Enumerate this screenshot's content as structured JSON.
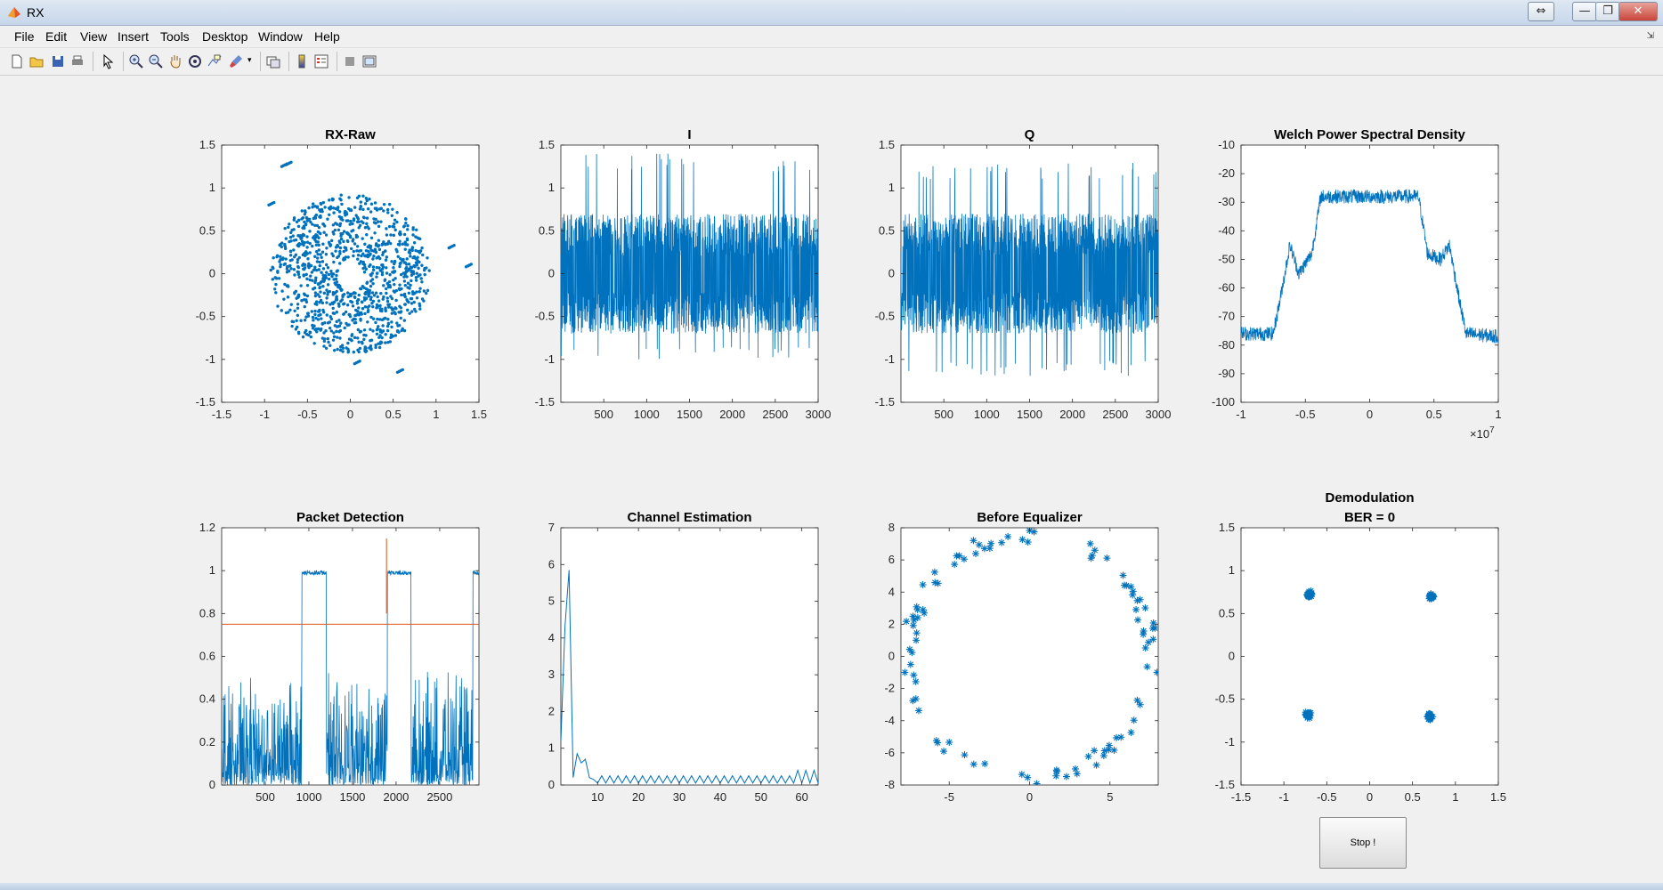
{
  "window": {
    "title": "RX",
    "controls": {
      "restore": "⇔",
      "minimize": "—",
      "maximize": "❐",
      "close": "✕"
    }
  },
  "menu": [
    "File",
    "Edit",
    "View",
    "Insert",
    "Tools",
    "Desktop",
    "Window",
    "Help"
  ],
  "toolbar": {
    "icons": [
      "new-figure-icon",
      "open-file-icon",
      "save-icon",
      "print-icon",
      "edit-plot-arrow-icon",
      "zoom-in-icon",
      "zoom-out-icon",
      "pan-hand-icon",
      "rotate-3d-icon",
      "data-cursor-icon",
      "brush-icon",
      "link-plot-icon",
      "colorbar-icon",
      "legend-icon",
      "hide-plot-tools-icon",
      "show-plot-tools-icon"
    ]
  },
  "stop_button": {
    "label": "Stop !"
  },
  "colors": {
    "series": "#0072bd",
    "threshold": "#d95319",
    "axes": "#262626"
  },
  "chart_data": [
    {
      "type": "scatter",
      "title": "RX-Raw",
      "xlim": [
        -1.5,
        1.5
      ],
      "ylim": [
        -1.5,
        1.5
      ],
      "xticks": [
        "-1.5",
        "-1",
        "-0.5",
        "0",
        "0.5",
        "1",
        "1.5"
      ],
      "yticks": [
        "-1.5",
        "-1",
        "-0.5",
        "0",
        "0.5",
        "1",
        "1.5"
      ],
      "marker": "dot",
      "description_of_points": "ring of points centred at origin radius up to ~0.9, plus outliers",
      "outliers": [
        [
          -0.8,
          1.25
        ],
        [
          -0.75,
          1.27
        ],
        [
          -0.95,
          0.8
        ],
        [
          1.15,
          0.3
        ],
        [
          1.35,
          0.08
        ],
        [
          0.55,
          -1.15
        ],
        [
          0.05,
          -1.05
        ]
      ]
    },
    {
      "type": "line",
      "title": "I",
      "xlim": [
        0,
        3000
      ],
      "ylim": [
        -1.5,
        1.5
      ],
      "xticks": [
        "500",
        "1000",
        "1500",
        "2000",
        "2500",
        "3000"
      ],
      "yticks": [
        "-1.5",
        "-1",
        "-0.5",
        "0",
        "0.5",
        "1",
        "1.5"
      ],
      "envelope": {
        "upper": 0.7,
        "lower": -0.7,
        "spike_max": 1.4,
        "spike_min": -1.0
      }
    },
    {
      "type": "line",
      "title": "Q",
      "xlim": [
        0,
        3000
      ],
      "ylim": [
        -1.5,
        1.5
      ],
      "xticks": [
        "500",
        "1000",
        "1500",
        "2000",
        "2500",
        "3000"
      ],
      "yticks": [
        "-1.5",
        "-1",
        "-0.5",
        "0",
        "0.5",
        "1",
        "1.5"
      ],
      "envelope": {
        "upper": 0.7,
        "lower": -0.7,
        "spike_max": 1.3,
        "spike_min": -1.2
      }
    },
    {
      "type": "line",
      "title": "Welch Power Spectral Density",
      "xlim": [
        -1,
        1
      ],
      "ylim": [
        -100,
        -10
      ],
      "xticks": [
        "-1",
        "-0.5",
        "0",
        "0.5",
        "1"
      ],
      "yticks": [
        "-100",
        "-90",
        "-80",
        "-70",
        "-60",
        "-50",
        "-40",
        "-30",
        "-20",
        "-10"
      ],
      "x_exponent": "7",
      "profile": [
        [
          -1,
          -76
        ],
        [
          -0.75,
          -76
        ],
        [
          -0.7,
          -65
        ],
        [
          -0.62,
          -45
        ],
        [
          -0.55,
          -55
        ],
        [
          -0.45,
          -48
        ],
        [
          -0.38,
          -28
        ],
        [
          0.38,
          -28
        ],
        [
          0.45,
          -48
        ],
        [
          0.55,
          -50
        ],
        [
          0.62,
          -45
        ],
        [
          0.7,
          -65
        ],
        [
          0.75,
          -76
        ],
        [
          1,
          -77
        ]
      ]
    },
    {
      "type": "line",
      "title": "Packet Detection",
      "xlim": [
        0,
        2950
      ],
      "ylim": [
        0,
        1.2
      ],
      "xticks": [
        "500",
        "1000",
        "1500",
        "2000",
        "2500"
      ],
      "yticks": [
        "0",
        "0.2",
        "0.4",
        "0.6",
        "0.8",
        "1",
        "1.2"
      ],
      "threshold": 0.75,
      "plateaus": [
        [
          920,
          1200
        ],
        [
          1900,
          2170
        ],
        [
          2880,
          2950
        ]
      ],
      "marker_x": 1890,
      "marker_range": [
        0.8,
        1.15
      ]
    },
    {
      "type": "line",
      "title": "Channel Estimation",
      "xlim": [
        1,
        64
      ],
      "ylim": [
        0,
        7
      ],
      "xticks": [
        "10",
        "20",
        "30",
        "40",
        "50",
        "60"
      ],
      "yticks": [
        "0",
        "1",
        "2",
        "3",
        "4",
        "5",
        "6",
        "7"
      ],
      "head": [
        [
          1,
          1.2
        ],
        [
          2,
          4.3
        ],
        [
          3,
          5.85
        ],
        [
          4,
          0.2
        ],
        [
          5,
          0.85
        ],
        [
          6,
          0.6
        ],
        [
          7,
          0.7
        ],
        [
          8,
          0.2
        ],
        [
          9,
          0.15
        ]
      ],
      "tail_level": 0.15
    },
    {
      "type": "scatter",
      "title": "Before Equalizer",
      "xlim": [
        -8,
        8
      ],
      "ylim": [
        -8,
        8
      ],
      "xticks": [
        "-5",
        "0",
        "5"
      ],
      "yticks": [
        "-8",
        "-6",
        "-4",
        "-2",
        "0",
        "2",
        "4",
        "6",
        "8"
      ],
      "marker": "asterisk",
      "ring_radius": 7.7
    },
    {
      "type": "scatter",
      "title": "Demodulation",
      "subtitle": "BER = 0",
      "xlim": [
        -1.5,
        1.5
      ],
      "ylim": [
        -1.5,
        1.5
      ],
      "xticks": [
        "-1.5",
        "-1",
        "-0.5",
        "0",
        "0.5",
        "1",
        "1.5"
      ],
      "yticks": [
        "-1.5",
        "-1",
        "-0.5",
        "0",
        "0.5",
        "1",
        "1.5"
      ],
      "marker": "asterisk",
      "clusters": [
        [
          -0.7,
          0.72
        ],
        [
          0.72,
          0.7
        ],
        [
          -0.72,
          -0.68
        ],
        [
          0.7,
          -0.7
        ]
      ]
    }
  ]
}
